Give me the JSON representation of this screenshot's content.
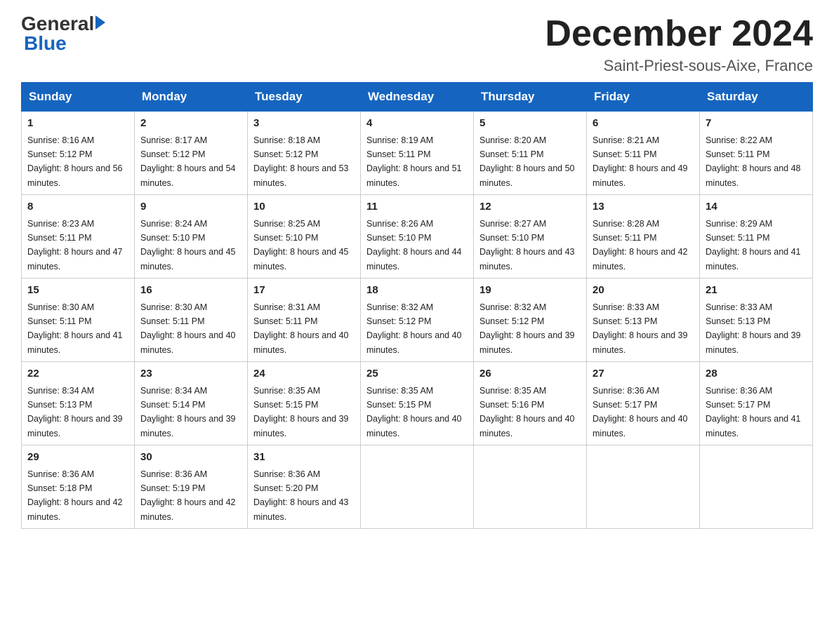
{
  "logo": {
    "general": "General",
    "blue": "Blue"
  },
  "title": "December 2024",
  "subtitle": "Saint-Priest-sous-Aixe, France",
  "weekdays": [
    "Sunday",
    "Monday",
    "Tuesday",
    "Wednesday",
    "Thursday",
    "Friday",
    "Saturday"
  ],
  "weeks": [
    [
      {
        "day": "1",
        "sunrise": "8:16 AM",
        "sunset": "5:12 PM",
        "daylight": "8 hours and 56 minutes."
      },
      {
        "day": "2",
        "sunrise": "8:17 AM",
        "sunset": "5:12 PM",
        "daylight": "8 hours and 54 minutes."
      },
      {
        "day": "3",
        "sunrise": "8:18 AM",
        "sunset": "5:12 PM",
        "daylight": "8 hours and 53 minutes."
      },
      {
        "day": "4",
        "sunrise": "8:19 AM",
        "sunset": "5:11 PM",
        "daylight": "8 hours and 51 minutes."
      },
      {
        "day": "5",
        "sunrise": "8:20 AM",
        "sunset": "5:11 PM",
        "daylight": "8 hours and 50 minutes."
      },
      {
        "day": "6",
        "sunrise": "8:21 AM",
        "sunset": "5:11 PM",
        "daylight": "8 hours and 49 minutes."
      },
      {
        "day": "7",
        "sunrise": "8:22 AM",
        "sunset": "5:11 PM",
        "daylight": "8 hours and 48 minutes."
      }
    ],
    [
      {
        "day": "8",
        "sunrise": "8:23 AM",
        "sunset": "5:11 PM",
        "daylight": "8 hours and 47 minutes."
      },
      {
        "day": "9",
        "sunrise": "8:24 AM",
        "sunset": "5:10 PM",
        "daylight": "8 hours and 45 minutes."
      },
      {
        "day": "10",
        "sunrise": "8:25 AM",
        "sunset": "5:10 PM",
        "daylight": "8 hours and 45 minutes."
      },
      {
        "day": "11",
        "sunrise": "8:26 AM",
        "sunset": "5:10 PM",
        "daylight": "8 hours and 44 minutes."
      },
      {
        "day": "12",
        "sunrise": "8:27 AM",
        "sunset": "5:10 PM",
        "daylight": "8 hours and 43 minutes."
      },
      {
        "day": "13",
        "sunrise": "8:28 AM",
        "sunset": "5:11 PM",
        "daylight": "8 hours and 42 minutes."
      },
      {
        "day": "14",
        "sunrise": "8:29 AM",
        "sunset": "5:11 PM",
        "daylight": "8 hours and 41 minutes."
      }
    ],
    [
      {
        "day": "15",
        "sunrise": "8:30 AM",
        "sunset": "5:11 PM",
        "daylight": "8 hours and 41 minutes."
      },
      {
        "day": "16",
        "sunrise": "8:30 AM",
        "sunset": "5:11 PM",
        "daylight": "8 hours and 40 minutes."
      },
      {
        "day": "17",
        "sunrise": "8:31 AM",
        "sunset": "5:11 PM",
        "daylight": "8 hours and 40 minutes."
      },
      {
        "day": "18",
        "sunrise": "8:32 AM",
        "sunset": "5:12 PM",
        "daylight": "8 hours and 40 minutes."
      },
      {
        "day": "19",
        "sunrise": "8:32 AM",
        "sunset": "5:12 PM",
        "daylight": "8 hours and 39 minutes."
      },
      {
        "day": "20",
        "sunrise": "8:33 AM",
        "sunset": "5:13 PM",
        "daylight": "8 hours and 39 minutes."
      },
      {
        "day": "21",
        "sunrise": "8:33 AM",
        "sunset": "5:13 PM",
        "daylight": "8 hours and 39 minutes."
      }
    ],
    [
      {
        "day": "22",
        "sunrise": "8:34 AM",
        "sunset": "5:13 PM",
        "daylight": "8 hours and 39 minutes."
      },
      {
        "day": "23",
        "sunrise": "8:34 AM",
        "sunset": "5:14 PM",
        "daylight": "8 hours and 39 minutes."
      },
      {
        "day": "24",
        "sunrise": "8:35 AM",
        "sunset": "5:15 PM",
        "daylight": "8 hours and 39 minutes."
      },
      {
        "day": "25",
        "sunrise": "8:35 AM",
        "sunset": "5:15 PM",
        "daylight": "8 hours and 40 minutes."
      },
      {
        "day": "26",
        "sunrise": "8:35 AM",
        "sunset": "5:16 PM",
        "daylight": "8 hours and 40 minutes."
      },
      {
        "day": "27",
        "sunrise": "8:36 AM",
        "sunset": "5:17 PM",
        "daylight": "8 hours and 40 minutes."
      },
      {
        "day": "28",
        "sunrise": "8:36 AM",
        "sunset": "5:17 PM",
        "daylight": "8 hours and 41 minutes."
      }
    ],
    [
      {
        "day": "29",
        "sunrise": "8:36 AM",
        "sunset": "5:18 PM",
        "daylight": "8 hours and 42 minutes."
      },
      {
        "day": "30",
        "sunrise": "8:36 AM",
        "sunset": "5:19 PM",
        "daylight": "8 hours and 42 minutes."
      },
      {
        "day": "31",
        "sunrise": "8:36 AM",
        "sunset": "5:20 PM",
        "daylight": "8 hours and 43 minutes."
      },
      null,
      null,
      null,
      null
    ]
  ],
  "labels": {
    "sunrise_prefix": "Sunrise: ",
    "sunset_prefix": "Sunset: ",
    "daylight_prefix": "Daylight: "
  }
}
